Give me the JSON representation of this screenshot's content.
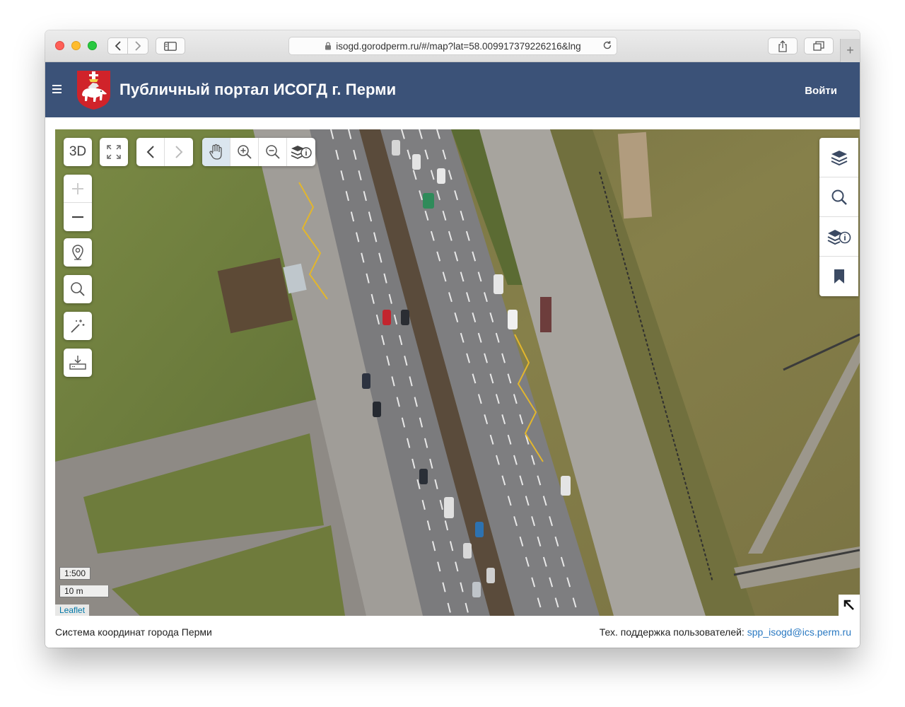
{
  "browser": {
    "url": "isogd.gorodperm.ru/#/map?lat=58.009917379226216&lng"
  },
  "header": {
    "title": "Публичный портал ИСОГД г. Перми",
    "login_label": "Войти"
  },
  "map_toolbar": {
    "btn_3d": "3D"
  },
  "map": {
    "scale_ratio": "1:500",
    "scale_bar": "10 m",
    "attribution": "Leaflet"
  },
  "footer": {
    "coordinate_system": "Система координат города Перми",
    "support_label": "Тех. поддержка пользователей:",
    "support_email": "spp_isogd@ics.perm.ru"
  },
  "icons": {
    "accent": "#3b5278",
    "coat_red": "#d0232a"
  }
}
